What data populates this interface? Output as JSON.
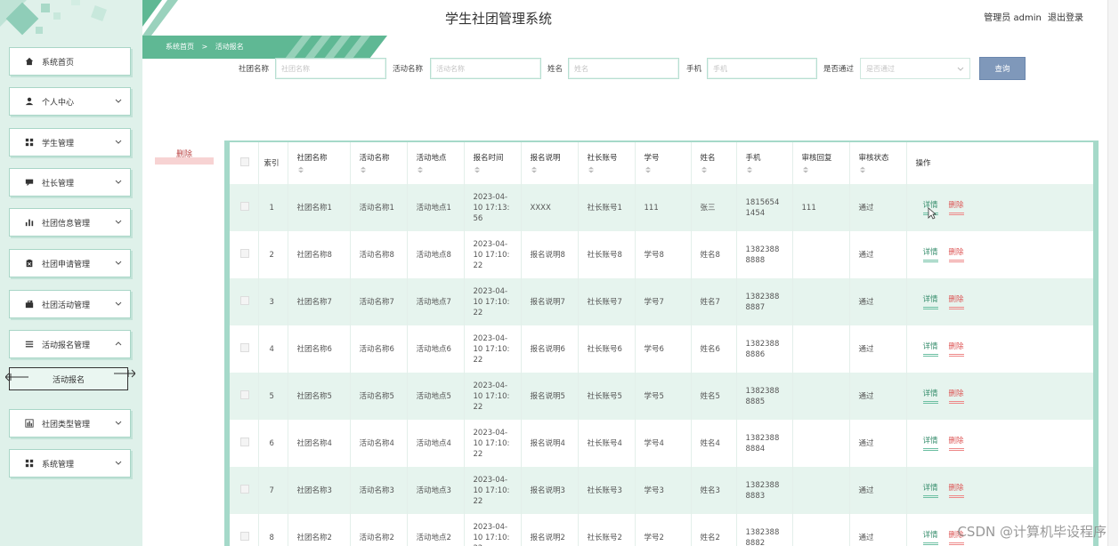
{
  "app": {
    "title": "学生社团管理系统",
    "user_label": "管理员 admin",
    "logout_label": "退出登录"
  },
  "breadcrumb": {
    "home": "系统首页",
    "separator": ">",
    "current": "活动报名"
  },
  "sidebar": {
    "items": [
      {
        "label": "系统首页",
        "icon": "home-icon",
        "has_chevron": false
      },
      {
        "label": "个人中心",
        "icon": "user-icon",
        "has_chevron": true
      },
      {
        "label": "学生管理",
        "icon": "grid-icon",
        "has_chevron": true
      },
      {
        "label": "社长管理",
        "icon": "chat-icon",
        "has_chevron": true
      },
      {
        "label": "社团信息管理",
        "icon": "chart-icon",
        "has_chevron": true
      },
      {
        "label": "社团申请管理",
        "icon": "clipboard-icon",
        "has_chevron": true
      },
      {
        "label": "社团活动管理",
        "icon": "briefcase-icon",
        "has_chevron": true
      },
      {
        "label": "活动报名管理",
        "icon": "list-icon",
        "has_chevron": true,
        "expanded": true
      },
      {
        "label": "社团类型管理",
        "icon": "bar-chart-icon",
        "has_chevron": true
      },
      {
        "label": "系统管理",
        "icon": "grid-icon",
        "has_chevron": true
      }
    ],
    "sub_item": "活动报名"
  },
  "search": {
    "club_name_label": "社团名称",
    "club_name_placeholder": "社团名称",
    "activity_name_label": "活动名称",
    "activity_name_placeholder": "活动名称",
    "name_label": "姓名",
    "name_placeholder": "姓名",
    "phone_label": "手机",
    "phone_placeholder": "手机",
    "approved_label": "是否通过",
    "approved_placeholder": "是否通过",
    "query_button": "查询"
  },
  "actions": {
    "delete_button": "删除"
  },
  "table": {
    "headers": [
      "索引",
      "社团名称",
      "活动名称",
      "活动地点",
      "报名时间",
      "报名说明",
      "社长账号",
      "学号",
      "姓名",
      "手机",
      "审核回复",
      "审核状态",
      "操作"
    ],
    "detail_label": "详情",
    "delete_label": "删除",
    "rows": [
      {
        "index": "1",
        "club": "社团名称1",
        "activity": "活动名称1",
        "location": "活动地点1",
        "time": "2023-04-10 17:13:56",
        "desc": "XXXX",
        "leader": "社长账号1",
        "sid": "111",
        "name": "张三",
        "phone": "18156541454",
        "reply": "111",
        "status": "通过"
      },
      {
        "index": "2",
        "club": "社团名称8",
        "activity": "活动名称8",
        "location": "活动地点8",
        "time": "2023-04-10 17:10:22",
        "desc": "报名说明8",
        "leader": "社长账号8",
        "sid": "学号8",
        "name": "姓名8",
        "phone": "13823888888",
        "reply": "",
        "status": "通过"
      },
      {
        "index": "3",
        "club": "社团名称7",
        "activity": "活动名称7",
        "location": "活动地点7",
        "time": "2023-04-10 17:10:22",
        "desc": "报名说明7",
        "leader": "社长账号7",
        "sid": "学号7",
        "name": "姓名7",
        "phone": "13823888887",
        "reply": "",
        "status": "通过"
      },
      {
        "index": "4",
        "club": "社团名称6",
        "activity": "活动名称6",
        "location": "活动地点6",
        "time": "2023-04-10 17:10:22",
        "desc": "报名说明6",
        "leader": "社长账号6",
        "sid": "学号6",
        "name": "姓名6",
        "phone": "13823888886",
        "reply": "",
        "status": "通过"
      },
      {
        "index": "5",
        "club": "社团名称5",
        "activity": "活动名称5",
        "location": "活动地点5",
        "time": "2023-04-10 17:10:22",
        "desc": "报名说明5",
        "leader": "社长账号5",
        "sid": "学号5",
        "name": "姓名5",
        "phone": "13823888885",
        "reply": "",
        "status": "通过"
      },
      {
        "index": "6",
        "club": "社团名称4",
        "activity": "活动名称4",
        "location": "活动地点4",
        "time": "2023-04-10 17:10:22",
        "desc": "报名说明4",
        "leader": "社长账号4",
        "sid": "学号4",
        "name": "姓名4",
        "phone": "13823888884",
        "reply": "",
        "status": "通过"
      },
      {
        "index": "7",
        "club": "社团名称3",
        "activity": "活动名称3",
        "location": "活动地点3",
        "time": "2023-04-10 17:10:22",
        "desc": "报名说明3",
        "leader": "社长账号3",
        "sid": "学号3",
        "name": "姓名3",
        "phone": "13823888883",
        "reply": "",
        "status": "通过"
      },
      {
        "index": "8",
        "club": "社团名称2",
        "activity": "活动名称2",
        "location": "活动地点2",
        "time": "2023-04-10 17:10:22",
        "desc": "报名说明2",
        "leader": "社长账号2",
        "sid": "学号2",
        "name": "姓名2",
        "phone": "13823888882",
        "reply": "",
        "status": "通过"
      }
    ]
  },
  "watermark": "CSDN @计算机毕设程序",
  "colors": {
    "accent": "#5fb894",
    "sidebar_bg": "#dff1ea",
    "query_button": "#7f98ba",
    "row_stripe": "#e6f4ee",
    "delete_red": "#dd5555"
  }
}
